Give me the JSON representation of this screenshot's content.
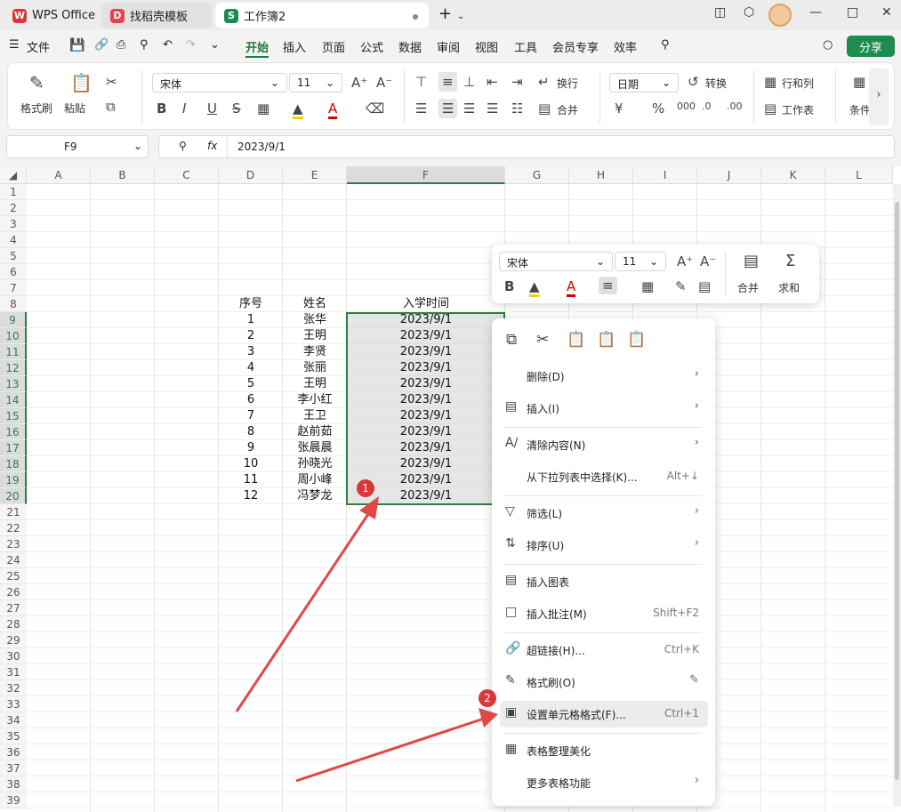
{
  "tabs": {
    "wps": "WPS Office",
    "template": "找稻壳模板",
    "workbook": "工作簿2"
  },
  "menu": {
    "file": "文件",
    "items": [
      "开始",
      "插入",
      "页面",
      "公式",
      "数据",
      "审阅",
      "视图",
      "工具",
      "会员专享",
      "效率"
    ],
    "share": "分享"
  },
  "ribbon": {
    "format_painter": "格式刷",
    "paste": "粘贴",
    "font_name": "宋体",
    "font_size": "11",
    "wrap": "换行",
    "merge": "合并",
    "number_format": "日期",
    "convert": "转换",
    "rows_cols": "行和列",
    "worksheet": "工作表",
    "cond": "条件"
  },
  "formula_bar": {
    "name_box": "F9",
    "fx": "fx",
    "value": "2023/9/1"
  },
  "columns": [
    "A",
    "B",
    "C",
    "D",
    "E",
    "F",
    "G",
    "H",
    "I",
    "J",
    "K",
    "L"
  ],
  "rows": [
    "1",
    "2",
    "3",
    "4",
    "5",
    "6",
    "7",
    "8",
    "9",
    "10",
    "11",
    "12",
    "13",
    "14",
    "15",
    "16",
    "17",
    "18",
    "19",
    "20",
    "21",
    "22",
    "23",
    "24",
    "25",
    "26",
    "27",
    "28",
    "29",
    "30",
    "31",
    "32",
    "33",
    "34",
    "35",
    "36",
    "37",
    "38",
    "39"
  ],
  "table": {
    "headers": [
      "序号",
      "姓名",
      "入学时间"
    ],
    "rows": [
      [
        "1",
        "张华",
        "2023/9/1"
      ],
      [
        "2",
        "王明",
        "2023/9/1"
      ],
      [
        "3",
        "李贤",
        "2023/9/1"
      ],
      [
        "4",
        "张丽",
        "2023/9/1"
      ],
      [
        "5",
        "王明",
        "2023/9/1"
      ],
      [
        "6",
        "李小红",
        "2023/9/1"
      ],
      [
        "7",
        "王卫",
        "2023/9/1"
      ],
      [
        "8",
        "赵前茹",
        "2023/9/1"
      ],
      [
        "9",
        "张晨晨",
        "2023/9/1"
      ],
      [
        "10",
        "孙晓光",
        "2023/9/1"
      ],
      [
        "11",
        "周小峰",
        "2023/9/1"
      ],
      [
        "12",
        "冯梦龙",
        "2023/9/1"
      ]
    ]
  },
  "mini_toolbar": {
    "font_name": "宋体",
    "font_size": "11",
    "merge": "合并",
    "sum": "求和"
  },
  "context_menu": {
    "delete": "删除(D)",
    "insert": "插入(I)",
    "clear": "清除内容(N)",
    "pick_list": "从下拉列表中选择(K)...",
    "pick_list_key": "Alt+↓",
    "filter": "筛选(L)",
    "sort": "排序(U)",
    "insert_chart": "插入图表",
    "insert_comment": "插入批注(M)",
    "insert_comment_key": "Shift+F2",
    "hyperlink": "超链接(H)...",
    "hyperlink_key": "Ctrl+K",
    "format_painter": "格式刷(O)",
    "format_cells": "设置单元格格式(F)...",
    "format_cells_key": "Ctrl+1",
    "beautify": "表格整理美化",
    "more": "更多表格功能"
  },
  "annotations": {
    "badge1": "1",
    "badge2": "2",
    "badge_color": "#d9383a"
  },
  "colors": {
    "accent": "#1e7a3f",
    "selection_border": "#2e7d43"
  }
}
